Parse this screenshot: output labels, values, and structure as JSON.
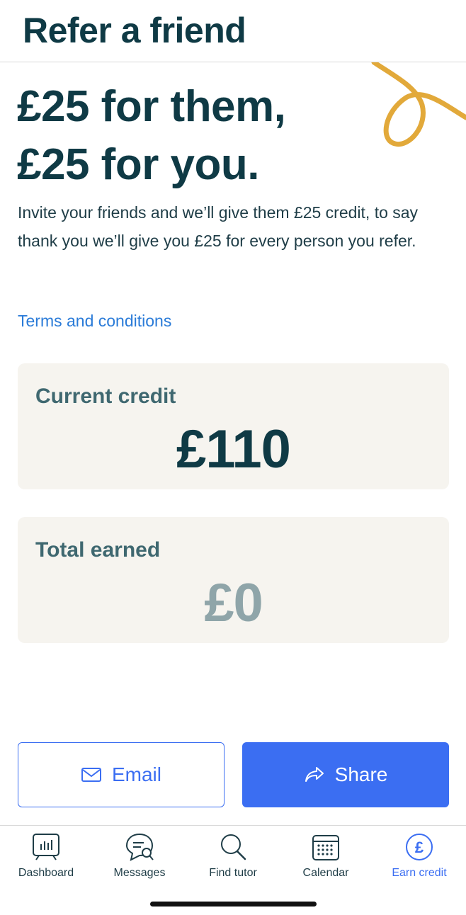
{
  "header": {
    "title": "Refer a friend"
  },
  "hero": {
    "line1": "£25 for them,",
    "line2": "£25 for you."
  },
  "intro": "Invite your friends and we’ll give them £25 credit, to say thank you we’ll give you £25 for every person you refer.",
  "terms_link": "Terms and conditions",
  "cards": [
    {
      "label": "Current credit",
      "amount": "£110"
    },
    {
      "label": "Total earned",
      "amount": "£0"
    }
  ],
  "actions": {
    "email_label": "Email",
    "email_icon": "mail-icon",
    "share_label": "Share",
    "share_icon": "share-icon"
  },
  "tabbar": [
    {
      "label": "Dashboard",
      "icon": "dashboard-icon",
      "active": false
    },
    {
      "label": "Messages",
      "icon": "messages-icon",
      "active": false
    },
    {
      "label": "Find tutor",
      "icon": "search-icon",
      "active": false
    },
    {
      "label": "Calendar",
      "icon": "calendar-icon",
      "active": false
    },
    {
      "label": "Earn credit",
      "icon": "pound-icon",
      "active": true
    }
  ],
  "colors": {
    "primary": "#3b6ef2",
    "heading": "#0f3a45",
    "link": "#2a7bd8",
    "card_bg": "#f6f4ef",
    "accent_squiggle": "#e2a93a",
    "muted_amount": "#8fa5a9"
  }
}
